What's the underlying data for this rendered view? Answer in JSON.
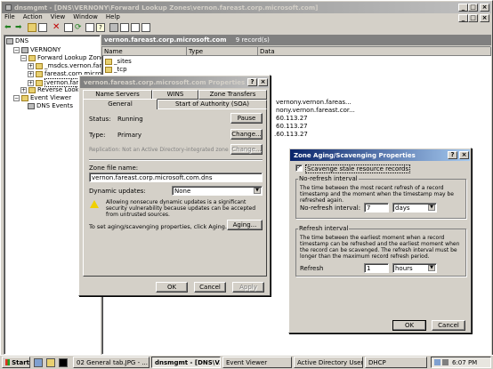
{
  "main_window": {
    "title": "dnsmgmt - [DNS\\VERNONY\\Forward Lookup Zones\\vernon.fareast.corp.microsoft.com]",
    "menu": [
      "File",
      "Action",
      "View",
      "Window",
      "Help"
    ]
  },
  "tree": {
    "items": [
      "DNS",
      "VERNONY",
      "Forward Lookup Zones",
      "_msdcs.vernon.fareast.c",
      "fareast.corp.microsoft.cc",
      "vernon.fareast.co",
      "Reverse Lookup Zon",
      "Event Viewer",
      "DNS Events"
    ]
  },
  "right_pane": {
    "zone": "vernon.fareast.corp.microsoft.com",
    "count": "9 record(s)",
    "columns": [
      "Name",
      "Type",
      "Data"
    ],
    "rows": [
      "_sites",
      "_tcp",
      "vernony.vernon.fareas...",
      "nony.vernon.fareast.cor...",
      "60.113.27",
      "60.113.27",
      ".60.113.27"
    ]
  },
  "properties_dialog": {
    "title": "vernon.fareast.corp.microsoft.com Properties",
    "tabs_back": [
      "Name Servers",
      "WINS",
      "Zone Transfers"
    ],
    "tabs_front": [
      "General",
      "Start of Authority (SOA)"
    ],
    "status_label": "Status:",
    "status_value": "Running",
    "pause_button": "Pause",
    "type_label": "Type:",
    "type_value": "Primary",
    "change_button": "Change...",
    "replication_text": "Replication:  Not an Active Directory-integrated zone",
    "change2_button": "Change...",
    "zone_file_label": "Zone file name:",
    "zone_file_value": "vernon.fareast.corp.microsoft.com.dns",
    "dynamic_label": "Dynamic updates:",
    "dynamic_value": "None",
    "warning_text": "Allowing nonsecure dynamic updates is a significant security vulnerability because updates can be accepted from untrusted sources.",
    "aging_text": "To set aging/scavenging properties, click Aging.",
    "aging_button": "Aging...",
    "ok": "OK",
    "cancel": "Cancel",
    "apply": "Apply"
  },
  "aging_dialog": {
    "title": "Zone Aging/Scavenging Properties",
    "scavenge_label": "Scavenge stale resource records",
    "scavenge_checked": true,
    "no_refresh_group": "No-refresh interval",
    "no_refresh_desc": "The time between the most recent refresh of a record timestamp and the moment when the timestamp may be refreshed again.",
    "no_refresh_label": "No-refresh interval:",
    "no_refresh_value": "7",
    "no_refresh_unit": "days",
    "refresh_group": "Refresh interval",
    "refresh_desc": "The time between the earliest moment when a record timestamp can be refreshed and the earliest moment when the record can be scavenged. The refresh interval must be longer than the maximum record refresh period.",
    "refresh_label": "Refresh",
    "refresh_value": "1",
    "refresh_unit": "hours",
    "ok": "OK",
    "cancel": "Cancel"
  },
  "taskbar": {
    "start": "Start",
    "tasks": [
      "02 General tab.JPG - ...",
      "dnsmgmt - [DNS\\V...",
      "Event Viewer",
      "Active Directory Users...",
      "DHCP"
    ],
    "clock": "6:07 PM"
  },
  "colors": {
    "desktop": "#3a6ea5",
    "title_active": "#0a246a",
    "title_inactive": "#808080",
    "face": "#d4d0c8"
  }
}
